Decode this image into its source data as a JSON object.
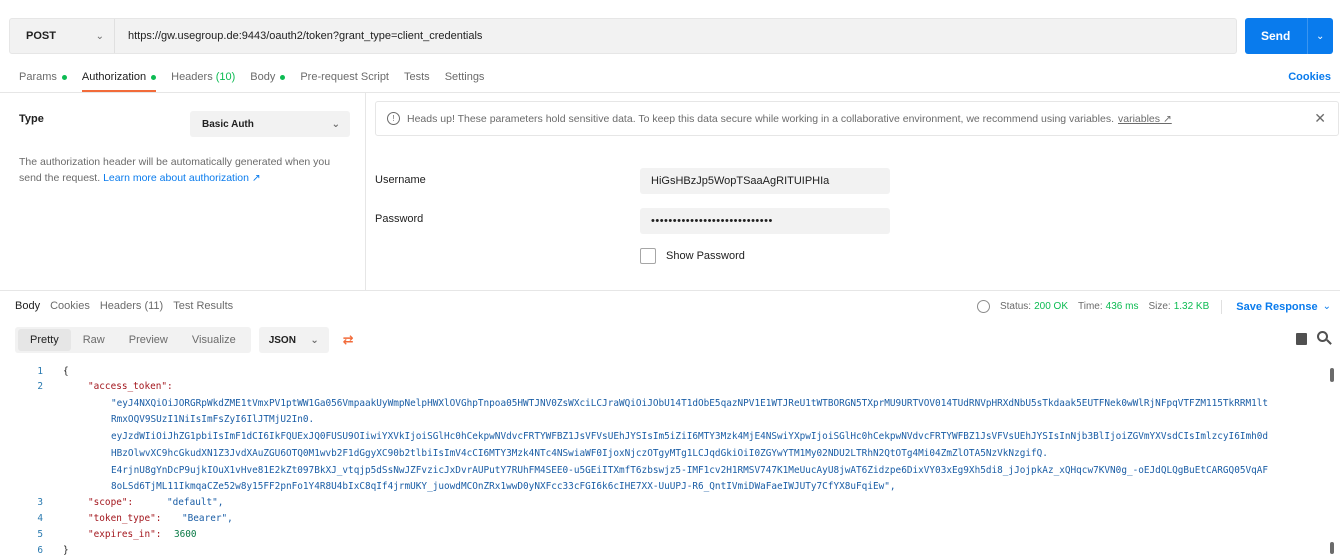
{
  "request": {
    "method": "POST",
    "url": "https://gw.usegroup.de:9443/oauth2/token?grant_type=client_credentials",
    "send_label": "Send"
  },
  "request_tabs": {
    "params": "Params",
    "authorization": "Authorization",
    "headers": "Headers",
    "headers_count": "(10)",
    "body": "Body",
    "prerequest": "Pre-request Script",
    "tests": "Tests",
    "settings": "Settings",
    "cookies": "Cookies"
  },
  "auth": {
    "type_label": "Type",
    "type_value": "Basic Auth",
    "help_text": "The authorization header will be automatically generated when you send the request.",
    "learn_more": "Learn more about authorization ↗",
    "notice": "Heads up! These parameters hold sensitive data. To keep this data secure while working in a collaborative environment, we recommend using variables.",
    "notice_link": "variables ↗",
    "username_label": "Username",
    "username_value": "HiGsHBzJp5WopTSaaAgRITUIPHIa",
    "password_label": "Password",
    "password_value": "••••••••••••••••••••••••••••",
    "show_password": "Show Password"
  },
  "response_tabs": {
    "body": "Body",
    "cookies": "Cookies",
    "headers": "Headers (11)",
    "test_results": "Test Results"
  },
  "response_status": {
    "status_label": "Status:",
    "status_value": "200 OK",
    "time_label": "Time:",
    "time_value": "436 ms",
    "size_label": "Size:",
    "size_value": "1.32 KB",
    "save_response": "Save Response"
  },
  "view": {
    "pretty": "Pretty",
    "raw": "Raw",
    "preview": "Preview",
    "visualize": "Visualize",
    "format": "JSON"
  },
  "code": {
    "line_numbers": [
      "1",
      "2",
      "3",
      "4",
      "5",
      "6"
    ],
    "open_brace": "{",
    "close_brace": "}",
    "access_token_key": "\"access_token\":",
    "token_lines": [
      "\"eyJ4NXQiOiJORGRpWkdZME1tVmxPV1ptWW1Ga056VmpaakUyWmpNelpHWXlOVGhpTnpoa05HWTJNV0ZsWXciLCJraWQiOiJObU14T1dObE5qazNPV1E1WTJReU1tWTBORGN5TXprMU9URTVOV014TUdRNVpHRXdNbU5sTkdaak5EUTFNek0wWlRjNFpqVTFZM115TkRRM1lt",
      "RmxOQV9SUzI1NiIsImFsZyI6IlJTMjU2In0.",
      "eyJzdWIiOiJhZG1pbiIsImF1dCI6IkFQUExJQ0FUSU9OIiwiYXVkIjoiSGlHc0hCekpwNVdvcFRTYWFBZ1JsVFVsUEhJYSIsIm5iZiI6MTY3Mzk4MjE4NSwiYXpwIjoiSGlHc0hCekpwNVdvcFRTYWFBZ1JsVFVsUEhJYSIsInNjb3BlIjoiZGVmYXVsdCIsImlzcyI6Imh0d",
      "HBzOlwvXC9hcGkudXN1Z3JvdXAuZGU6OTQ0M1wvb2F1dGgyXC90b2tlbiIsImV4cCI6MTY3Mzk4NTc4NSwiaWF0IjoxNjczOTgyMTg1LCJqdGkiOiI0ZGYwYTM1My02NDU2LTRhN2QtOTg4Mi04ZmZlOTA5NzVkNzgifQ.",
      "E4rjnU8gYnDcP9ujkIOuX1vHve81E2kZt097BkXJ_vtqjp5dSsNwJZFvzicJxDvrAUPutY7RUhFM4SEE0-u5GEiITXmfT6zbswjz5-IMF1cv2H1RMSV747K1MeUucAyU8jwAT6Zidzpe6DixVY03xEg9Xh5di8_jJojpkAz_xQHqcw7KVN0g_-oEJdQLQgBuEtCARGQ05VqAF",
      "8oLSd6TjML11IkmqaCZe52w8y15FF2pnFo1Y4R8U4bIxC8qIf4jrmUKY_juowdMCOnZRx1wwD0yNXFcc33cFGI6k6cIHE7XX-UuUPJ-R6_QntIVmiDWaFaeIWJUTy7CfYX8uFqiEw\","
    ],
    "scope_key": "\"scope\":",
    "scope_value": "\"default\",",
    "token_type_key": "\"token_type\":",
    "token_type_value": "\"Bearer\",",
    "expires_key": "\"expires_in\":",
    "expires_value": "3600"
  },
  "colors": {
    "accent": "#097bed",
    "active_tab_underline": "#f26b3a",
    "status_green": "#0cbb52"
  }
}
